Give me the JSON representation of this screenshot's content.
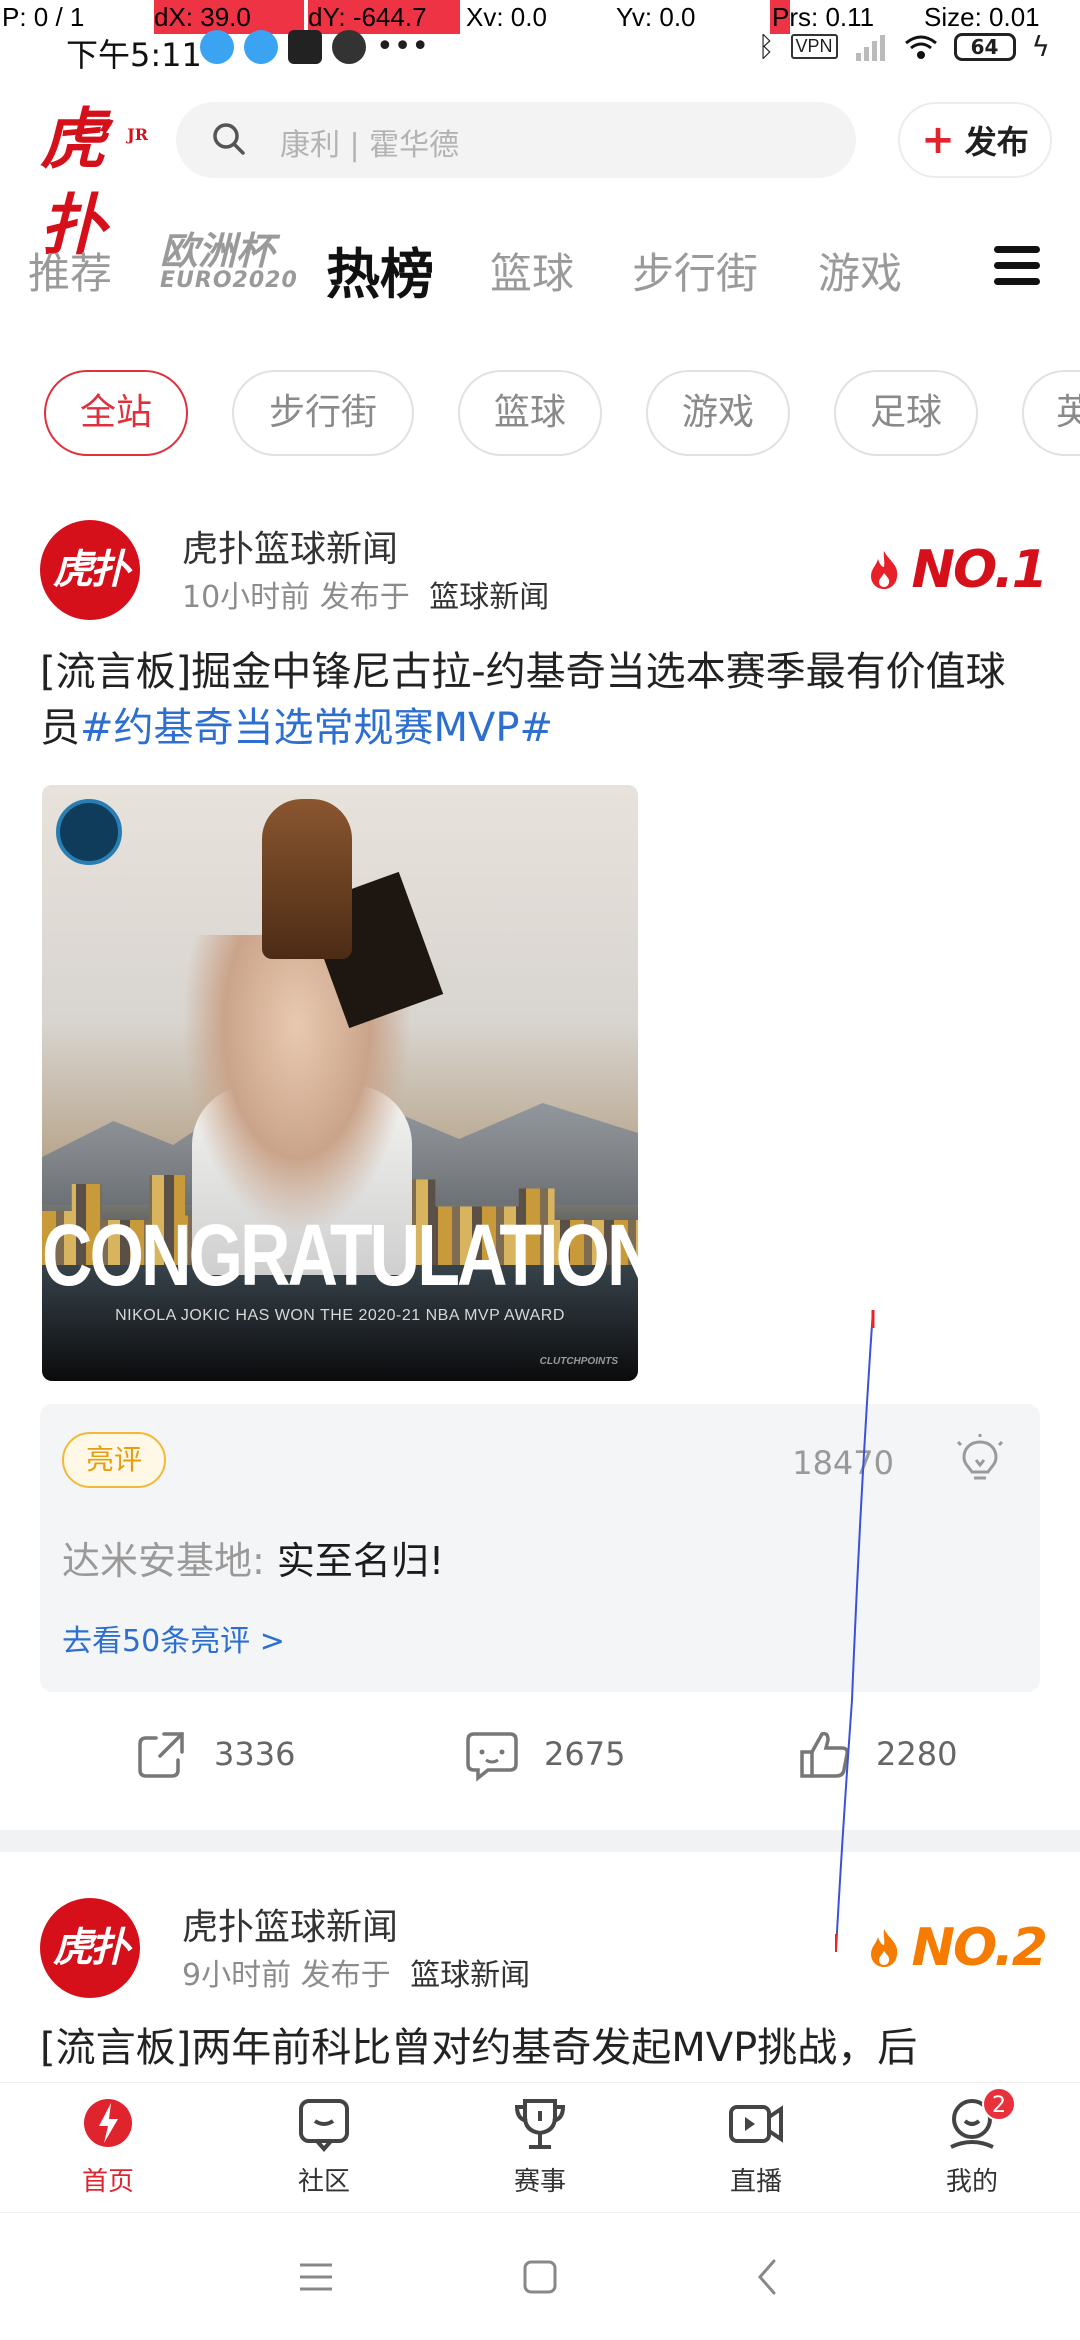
{
  "debug": {
    "p": "P: 0 / 1",
    "dx": "dX: 39.0",
    "dy": "dY: -644.7",
    "xv": "Xv: 0.0",
    "yv": "Yv: 0.0",
    "prs": "Prs: 0.11",
    "size": "Size: 0.01"
  },
  "status_bar": {
    "time": "下午5:11",
    "battery": "64",
    "vpn": "VPN"
  },
  "header": {
    "logo_text": "虎扑",
    "logo_badge": "JR",
    "search_placeholder": "康利 | 霍华德",
    "publish_label": "发布"
  },
  "nav_tabs": [
    {
      "label": "推荐"
    },
    {
      "label": "欧洲杯",
      "sub": "EURO2020"
    },
    {
      "label": "热榜"
    },
    {
      "label": "篮球"
    },
    {
      "label": "步行街"
    },
    {
      "label": "游戏"
    }
  ],
  "chips": [
    "全站",
    "步行街",
    "篮球",
    "游戏",
    "足球",
    "英"
  ],
  "posts": [
    {
      "author": "虎扑篮球新闻",
      "time": "10小时前",
      "published_in": "发布于",
      "board": "篮球新闻",
      "rank": "NO.1",
      "title_main": "[流言板]掘金中锋尼古拉-约基奇当选本赛季最有价值球员",
      "title_tag": "#约基奇当选常规赛MVP#",
      "image": {
        "headline": "CONGRATULATIONS",
        "subline": "NIKOLA JOKIC HAS WON THE 2020-21 NBA MVP AWARD",
        "watermark": "CLUTCHPOINTS"
      },
      "review": {
        "tag": "亮评",
        "likes": "18470",
        "user": "达米安基地:",
        "content": "实至名归!",
        "more": "去看50条亮评 >"
      },
      "shares": "3336",
      "comments": "2675",
      "likes": "2280"
    },
    {
      "author": "虎扑篮球新闻",
      "time": "9小时前",
      "published_in": "发布于",
      "board": "篮球新闻",
      "rank": "NO.2",
      "title_main": "[流言板]两年前科比曾对约基奇发起MVP挑战，后"
    }
  ],
  "bottom_nav": [
    {
      "label": "首页"
    },
    {
      "label": "社区"
    },
    {
      "label": "赛事"
    },
    {
      "label": "直播"
    },
    {
      "label": "我的",
      "badge": "2"
    }
  ],
  "colors": {
    "brand_red": "#d6101b",
    "accent_red": "#e0303a",
    "rank2_orange": "#f57c00",
    "link_blue": "#2c6fd1"
  }
}
